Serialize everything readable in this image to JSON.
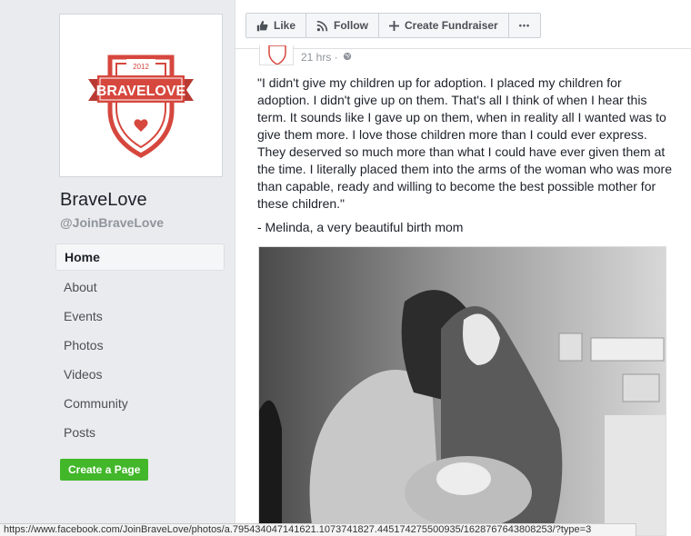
{
  "page": {
    "name": "BraveLove",
    "handle": "@JoinBraveLove"
  },
  "logo": {
    "year": "2012",
    "text": "BRAVELOVE",
    "color": "#d6473e"
  },
  "nav": {
    "items": [
      {
        "label": "Home",
        "active": true
      },
      {
        "label": "About"
      },
      {
        "label": "Events"
      },
      {
        "label": "Photos"
      },
      {
        "label": "Videos"
      },
      {
        "label": "Community"
      },
      {
        "label": "Posts"
      }
    ]
  },
  "create_page_button": "Create a Page",
  "action_bar": {
    "like": "Like",
    "follow": "Follow",
    "create_fundraiser": "Create Fundraiser",
    "more": "•••"
  },
  "post": {
    "time": "21 hrs ·",
    "text": "\"I didn't give my children up for adoption. I placed my children for adoption. I didn't give up on them. That's all I think of when I hear this term. It sounds like I gave up on them, when in reality all I wanted was to give them more. I love those children more than I could ever express. They deserved so much more than what I could have ever given them at the time. I literally placed them into the arms of the woman who was more than capable, ready and willing to become the best possible mother for these children.\"",
    "signature": "- Melinda, a very beautiful birth mom"
  },
  "status_bar": {
    "url": "https://www.facebook.com/JoinBraveLove/photos/a.795434047141621.1073741827.445174275500935/1628767643808253/?type=3"
  },
  "colors": {
    "accent_green": "#42b72a",
    "brand_red": "#d6473e"
  }
}
